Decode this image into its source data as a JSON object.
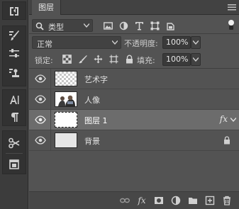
{
  "panel": {
    "tab_label": "图层"
  },
  "filter": {
    "kind_label": "类型"
  },
  "blend": {
    "mode_label": "正常",
    "opacity_label": "不透明度:",
    "opacity_value": "100%"
  },
  "locks": {
    "label": "锁定:",
    "fill_label": "填充:",
    "fill_value": "100%"
  },
  "layers": [
    {
      "name": "艺术字",
      "thumb": "transparent",
      "visible": true
    },
    {
      "name": "人像",
      "thumb": "photo",
      "visible": true
    },
    {
      "name": "图层 1",
      "thumb": "white",
      "visible": true,
      "selected": true,
      "fx": "fx"
    },
    {
      "name": "背景",
      "thumb": "gray",
      "visible": true,
      "locked": true
    }
  ],
  "footer": {
    "fx_label": "fx"
  },
  "colors": {
    "panel_bg": "#535353",
    "selected_row": "#6c6c6c",
    "tool_strip": "#3c3c3c"
  },
  "icons": {
    "filter": [
      "image-filter-icon",
      "adjustment-filter-icon",
      "type-filter-icon",
      "shape-filter-icon",
      "smart-object-filter-icon",
      "filter-toggle-icon"
    ],
    "lock": [
      "lock-transparent-pixels-icon",
      "lock-image-pixels-icon",
      "lock-position-icon",
      "lock-artboard-icon",
      "lock-all-icon"
    ],
    "footer": [
      "link-layers-icon",
      "fx-icon",
      "add-mask-icon",
      "adjustment-layer-icon",
      "new-group-icon",
      "new-layer-icon",
      "delete-layer-icon"
    ]
  }
}
